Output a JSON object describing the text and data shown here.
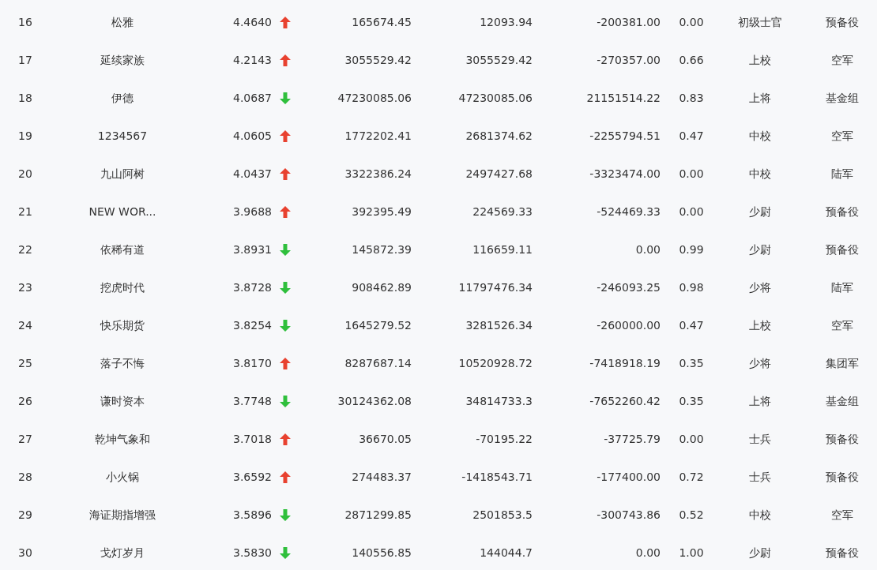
{
  "rows": [
    {
      "rank": "16",
      "name": "松雅",
      "score": "4.4640",
      "kind": "up",
      "column_4": "165674.45",
      "column_5": "12093.94",
      "column_6": "-200381.00",
      "column_7": "0.00",
      "column_8": "初级士官",
      "column_9": "预备役"
    },
    {
      "rank": "17",
      "name": "延续家族",
      "score": "4.2143",
      "kind": "up",
      "column_4": "3055529.42",
      "column_5": "3055529.42",
      "column_6": "-270357.00",
      "column_7": "0.66",
      "column_8": "上校",
      "column_9": "空军"
    },
    {
      "rank": "18",
      "name": "伊德",
      "score": "4.0687",
      "kind": "down",
      "column_4": "47230085.06",
      "column_5": "47230085.06",
      "column_6": "21151514.22",
      "column_7": "0.83",
      "column_8": "上将",
      "column_9": "基金组"
    },
    {
      "rank": "19",
      "name": "1234567",
      "score": "4.0605",
      "kind": "up",
      "column_4": "1772202.41",
      "column_5": "2681374.62",
      "column_6": "-2255794.51",
      "column_7": "0.47",
      "column_8": "中校",
      "column_9": "空军"
    },
    {
      "rank": "20",
      "name": "九山阿树",
      "score": "4.0437",
      "kind": "up",
      "column_4": "3322386.24",
      "column_5": "2497427.68",
      "column_6": "-3323474.00",
      "column_7": "0.00",
      "column_8": "中校",
      "column_9": "陆军"
    },
    {
      "rank": "21",
      "name": "NEW WOR...",
      "score": "3.9688",
      "kind": "up",
      "column_4": "392395.49",
      "column_5": "224569.33",
      "column_6": "-524469.33",
      "column_7": "0.00",
      "column_8": "少尉",
      "column_9": "预备役"
    },
    {
      "rank": "22",
      "name": "依稀有道",
      "score": "3.8931",
      "kind": "down",
      "column_4": "145872.39",
      "column_5": "116659.11",
      "column_6": "0.00",
      "column_7": "0.99",
      "column_8": "少尉",
      "column_9": "预备役"
    },
    {
      "rank": "23",
      "name": "挖虎时代",
      "score": "3.8728",
      "kind": "down",
      "column_4": "908462.89",
      "column_5": "11797476.34",
      "column_6": "-246093.25",
      "column_7": "0.98",
      "column_8": "少将",
      "column_9": "陆军"
    },
    {
      "rank": "24",
      "name": "快乐期货",
      "score": "3.8254",
      "kind": "down",
      "column_4": "1645279.52",
      "column_5": "3281526.34",
      "column_6": "-260000.00",
      "column_7": "0.47",
      "column_8": "上校",
      "column_9": "空军"
    },
    {
      "rank": "25",
      "name": "落子不悔",
      "score": "3.8170",
      "kind": "up",
      "column_4": "8287687.14",
      "column_5": "10520928.72",
      "column_6": "-7418918.19",
      "column_7": "0.35",
      "column_8": "少将",
      "column_9": "集团军"
    },
    {
      "rank": "26",
      "name": "谦时资本",
      "score": "3.7748",
      "kind": "down",
      "column_4": "30124362.08",
      "column_5": "34814733.3",
      "column_6": "-7652260.42",
      "column_7": "0.35",
      "column_8": "上将",
      "column_9": "基金组"
    },
    {
      "rank": "27",
      "name": "乾坤气象和",
      "score": "3.7018",
      "kind": "up",
      "column_4": "36670.05",
      "column_5": "-70195.22",
      "column_6": "-37725.79",
      "column_7": "0.00",
      "column_8": "士兵",
      "column_9": "预备役"
    },
    {
      "rank": "28",
      "name": "小火锅",
      "score": "3.6592",
      "kind": "up",
      "column_4": "274483.37",
      "column_5": "-1418543.71",
      "column_6": "-177400.00",
      "column_7": "0.72",
      "column_8": "士兵",
      "column_9": "预备役"
    },
    {
      "rank": "29",
      "name": "海证期指增强",
      "score": "3.5896",
      "kind": "down",
      "column_4": "2871299.85",
      "column_5": "2501853.5",
      "column_6": "-300743.86",
      "column_7": "0.52",
      "column_8": "中校",
      "column_9": "空军"
    },
    {
      "rank": "30",
      "name": "戈灯岁月",
      "score": "3.5830",
      "kind": "down",
      "column_4": "140556.85",
      "column_5": "144044.7",
      "column_6": "0.00",
      "column_7": "1.00",
      "column_8": "少尉",
      "column_9": "预备役"
    }
  ]
}
